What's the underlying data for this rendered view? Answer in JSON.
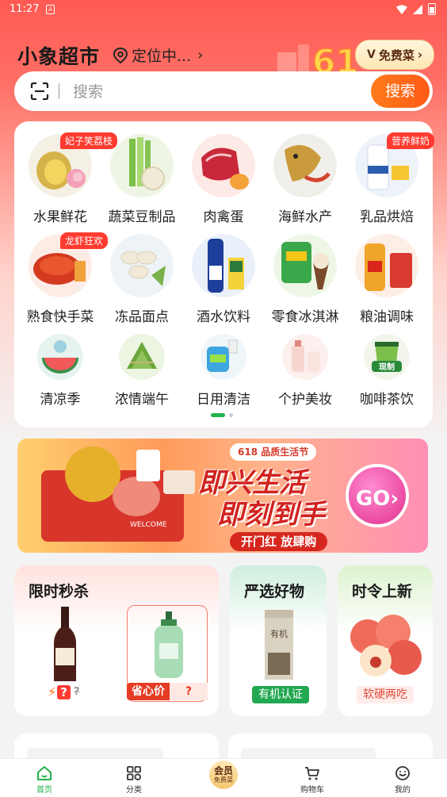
{
  "status": {
    "time": "11:27",
    "sim": "A"
  },
  "header": {
    "store_name": "小象超市",
    "location": "定位中...",
    "free_veg": "免费菜",
    "promo_deco": "61"
  },
  "search": {
    "placeholder": "搜索",
    "button": "搜索"
  },
  "categories": [
    {
      "label": "水果鲜花",
      "tag": "妃子笑荔枝"
    },
    {
      "label": "蔬菜豆制品"
    },
    {
      "label": "肉禽蛋"
    },
    {
      "label": "海鲜水产"
    },
    {
      "label": "乳品烘焙",
      "tag": "营养鲜奶"
    },
    {
      "label": "熟食快手菜",
      "tag": "龙虾狂欢"
    },
    {
      "label": "冻品面点"
    },
    {
      "label": "酒水饮料"
    },
    {
      "label": "零食冰淇淋"
    },
    {
      "label": "粮油调味"
    },
    {
      "label": "清凉季"
    },
    {
      "label": "浓情端午"
    },
    {
      "label": "日用清洁"
    },
    {
      "label": "个护美妆"
    },
    {
      "label": "咖啡茶饮",
      "image_text": "现制"
    }
  ],
  "banner": {
    "pill": "618 品质生活节",
    "line1": "即兴生活",
    "line2": "即刻到手",
    "cta": "开门红 放肆购",
    "go": "GO›",
    "sign": "WELCOME"
  },
  "promos": {
    "flash": {
      "title": "限时秒杀",
      "price1": "?",
      "price1_old": "?",
      "saver": "省心价",
      "price2": "?"
    },
    "select": {
      "title": "严选好物",
      "badge": "有机认证",
      "pack_text": "有机"
    },
    "season": {
      "title": "时令上新",
      "badge": "软硬两吃"
    }
  },
  "tabs": [
    {
      "label": "首页",
      "icon": "home-icon"
    },
    {
      "label": "分类",
      "icon": "category-icon"
    },
    {
      "label": "免费菜",
      "top": "会员",
      "icon": "member-icon"
    },
    {
      "label": "购物车",
      "icon": "cart-icon"
    },
    {
      "label": "我的",
      "icon": "profile-icon"
    }
  ],
  "colors": {
    "accent": "#22b14c",
    "orange": "#ff6a16",
    "red": "#ff3b30"
  }
}
